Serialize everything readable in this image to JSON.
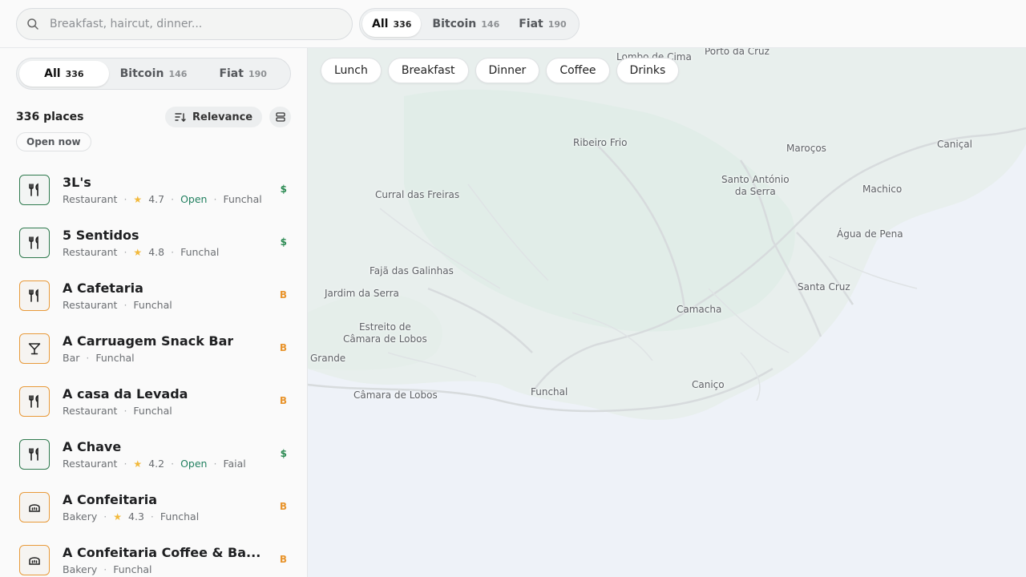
{
  "search": {
    "placeholder": "Breakfast, haircut, dinner..."
  },
  "currency_filter": {
    "options": [
      {
        "label": "All",
        "count": "336"
      },
      {
        "label": "Bitcoin",
        "count": "146"
      },
      {
        "label": "Fiat",
        "count": "190"
      }
    ],
    "selected": "All"
  },
  "list": {
    "count_label": "336 places",
    "sort_label": "Relevance",
    "open_now_label": "Open now"
  },
  "category_chips": [
    "Lunch",
    "Breakfast",
    "Dinner",
    "Coffee",
    "Drinks"
  ],
  "places": [
    {
      "name": "3L's",
      "category": "Restaurant",
      "rating": "4.7",
      "status": "Open",
      "location": "Funchal",
      "payment": "$",
      "payment_type": "fiat",
      "icon": "fork-knife-icon"
    },
    {
      "name": "5 Sentidos",
      "category": "Restaurant",
      "rating": "4.8",
      "status": "",
      "location": "Funchal",
      "payment": "$",
      "payment_type": "fiat",
      "icon": "fork-knife-icon"
    },
    {
      "name": "A Cafetaria",
      "category": "Restaurant",
      "rating": "",
      "status": "",
      "location": "Funchal",
      "payment": "B",
      "payment_type": "bitcoin",
      "icon": "fork-knife-icon"
    },
    {
      "name": "A Carruagem Snack Bar",
      "category": "Bar",
      "rating": "",
      "status": "",
      "location": "Funchal",
      "payment": "B",
      "payment_type": "bitcoin",
      "icon": "cocktail-icon"
    },
    {
      "name": "A casa da Levada",
      "category": "Restaurant",
      "rating": "",
      "status": "",
      "location": "Funchal",
      "payment": "B",
      "payment_type": "bitcoin",
      "icon": "fork-knife-icon"
    },
    {
      "name": "A Chave",
      "category": "Restaurant",
      "rating": "4.2",
      "status": "Open",
      "location": "Faial",
      "payment": "$",
      "payment_type": "fiat",
      "icon": "fork-knife-icon"
    },
    {
      "name": "A Confeitaria",
      "category": "Bakery",
      "rating": "4.3",
      "status": "",
      "location": "Funchal",
      "payment": "B",
      "payment_type": "bitcoin",
      "icon": "bread-icon"
    },
    {
      "name": "A Confeitaria Coffee & Ba...",
      "category": "Bakery",
      "rating": "",
      "status": "",
      "location": "Funchal",
      "payment": "B",
      "payment_type": "bitcoin",
      "icon": "bread-icon"
    }
  ],
  "map_labels": [
    "Lombo de Cima",
    "Porto da Cruz",
    "Ribeiro Frio",
    "Maroços",
    "Caniçal",
    "Curral das Freiras",
    "Santo António\nda Serra",
    "Machico",
    "Água de Pena",
    "Fajã das Galinhas",
    "Jardim da Serra",
    "Santa Cruz",
    "Camacha",
    "Estreito de\nCâmara de Lobos",
    "Grande",
    "Caniço",
    "Funchal",
    "Câmara de Lobos"
  ]
}
